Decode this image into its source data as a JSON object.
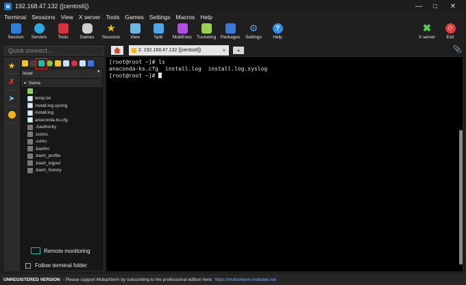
{
  "window": {
    "title": "192.168.47.132 ([centos6])"
  },
  "menu": [
    "Terminal",
    "Sessions",
    "View",
    "X server",
    "Tools",
    "Games",
    "Settings",
    "Macros",
    "Help"
  ],
  "toolbar": {
    "items": [
      {
        "label": "Session",
        "icon": "session-icon",
        "color": "#2f7fd6"
      },
      {
        "label": "Servers",
        "icon": "servers-icon",
        "color": "#2ea8e0"
      },
      {
        "label": "Tools",
        "icon": "tools-icon",
        "color": "#d8333b"
      },
      {
        "label": "Games",
        "icon": "games-icon",
        "color": "#cfcfcf"
      },
      {
        "label": "Sessions",
        "icon": "star-icon",
        "color": "#f2c21b"
      },
      {
        "label": "View",
        "icon": "view-icon",
        "color": "#6db6e0"
      },
      {
        "label": "Split",
        "icon": "split-icon",
        "color": "#4ea6e8"
      },
      {
        "label": "MultiExec",
        "icon": "multiexec-icon",
        "color": "#b14de0"
      },
      {
        "label": "Tunneling",
        "icon": "tunneling-icon",
        "color": "#9bd04f"
      },
      {
        "label": "Packages",
        "icon": "packages-icon",
        "color": "#3b78d8"
      },
      {
        "label": "Settings",
        "icon": "gear-icon",
        "color": "#5aa0e8"
      },
      {
        "label": "Help",
        "icon": "help-icon",
        "color": "#2f8fe8"
      }
    ],
    "right": [
      {
        "label": "X server",
        "icon": "xserver-icon",
        "color": "#4fd04f"
      },
      {
        "label": "Exit",
        "icon": "exit-icon",
        "color": "#e03a3a"
      }
    ]
  },
  "sidebar": {
    "quick_connect_placeholder": "Quick connect...",
    "path": "/root/",
    "column_header": "Name",
    "files": [
      "..",
      "temp.txt",
      "install.log.syslog",
      "install.log",
      "anaconda-ks.cfg",
      ".Xauthority",
      ".tcshrc",
      ".cshrc",
      ".bashrc",
      ".bash_profile",
      ".bash_logout",
      ".bash_history"
    ],
    "remote_monitoring": "Remote monitoring",
    "follow_terminal": "Follow terminal folder"
  },
  "tabs": {
    "active_label": "2. 192.168.47.132 ([centos6])"
  },
  "terminal": {
    "lines": [
      "[root@root ~]# ls",
      "anaconda-ks.cfg  install.log  install.log.syslog",
      "[root@root ~]# "
    ]
  },
  "status": {
    "unregistered": "UNREGISTERED VERSION",
    "message": "-  Please support MobaXterm by subscribing to the professional edition here:",
    "link": "https://mobaxterm.mobatek.net"
  }
}
